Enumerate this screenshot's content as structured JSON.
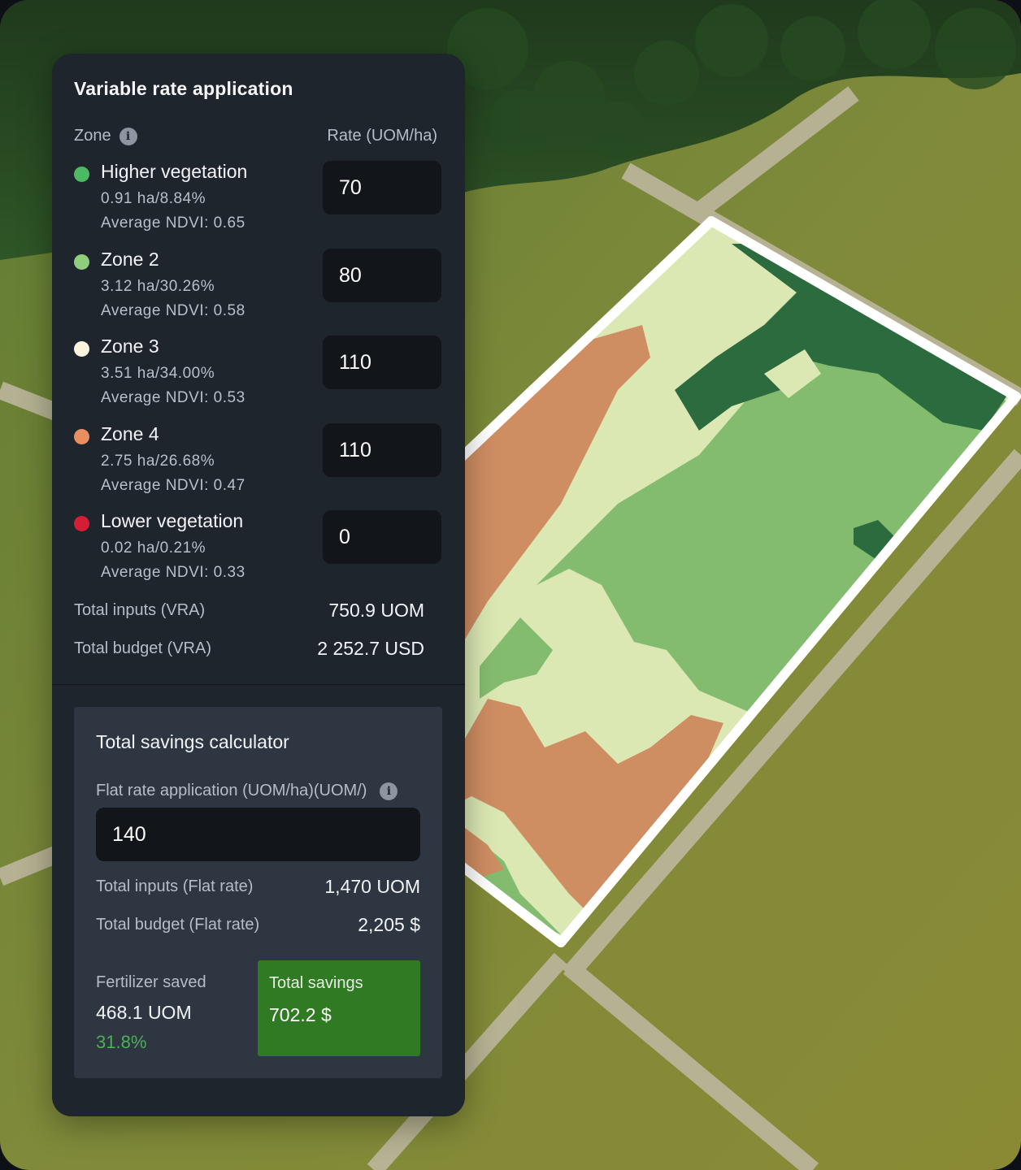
{
  "panel": {
    "title": "Variable rate application",
    "zone_header": "Zone",
    "rate_header": "Rate (UOM/ha)",
    "info_icon": "info-icon"
  },
  "zones": [
    {
      "name": "Higher vegetation",
      "area": "0.91 ha/8.84%",
      "ndvi": "Average NDVI: 0.65",
      "rate": "70",
      "color": "#4cb963"
    },
    {
      "name": "Zone 2",
      "area": "3.12 ha/30.26%",
      "ndvi": "Average NDVI: 0.58",
      "rate": "80",
      "color": "#8fcf7c"
    },
    {
      "name": "Zone 3",
      "area": "3.51 ha/34.00%",
      "ndvi": "Average NDVI: 0.53",
      "rate": "110",
      "color": "#fbf3dc"
    },
    {
      "name": "Zone 4",
      "area": "2.75 ha/26.68%",
      "ndvi": "Average NDVI: 0.47",
      "rate": "110",
      "color": "#e98e5e"
    },
    {
      "name": "Lower vegetation",
      "area": "0.02 ha/0.21%",
      "ndvi": "Average NDVI: 0.33",
      "rate": "0",
      "color": "#d41e35"
    }
  ],
  "totals": {
    "inputs_label": "Total inputs (VRA)",
    "inputs_value": "750.9 UOM",
    "budget_label": "Total budget (VRA)",
    "budget_value": "2 252.7 USD"
  },
  "calculator": {
    "title": "Total savings calculator",
    "flat_label": "Flat rate application (UOM/ha)(UOM/)",
    "flat_value": "140",
    "inputs_label": "Total inputs (Flat rate)",
    "inputs_value": "1,470 UOM",
    "budget_label": "Total budget (Flat rate)",
    "budget_value": "2,205 $",
    "fert_saved_label": "Fertilizer saved",
    "fert_saved_value": "468.1 UOM",
    "fert_saved_pct": "31.8%",
    "total_savings_label": "Total savings",
    "total_savings_value": "702.2 $"
  },
  "map": {
    "zone_colors": {
      "darkest": "#2c6b3e",
      "medium": "#84bc6f",
      "light": "#dbe8b4",
      "brown": "#cf8d62"
    }
  }
}
